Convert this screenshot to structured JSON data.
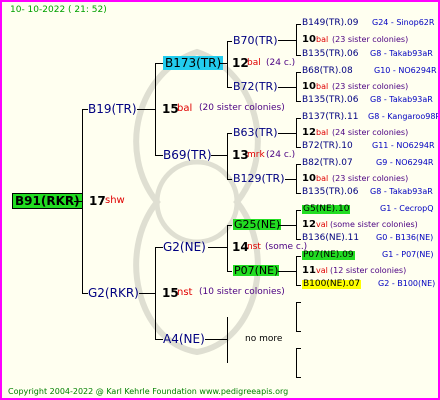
{
  "date": "10- 10-2022 ( 21: 52)",
  "footer": "Copyright 2004-2022 @ Karl Kehrle Foundation    www.pedigreeapis.org",
  "colors": {
    "frame": "#ff00ff",
    "highlight_green": "#22dd22",
    "highlight_cyan": "#22ccee",
    "highlight_yellow": "#ffff00",
    "red": "#e00000",
    "blue": "#0000c0"
  },
  "root": {
    "label": "B91(RKR)",
    "num": "17",
    "tag": "shw"
  },
  "gen1": [
    {
      "label": "B19(TR)",
      "num": "15",
      "tag": "bal",
      "note": "(20 sister colonies)"
    },
    {
      "label": "G2(RKR)",
      "num": "15",
      "tag": "nst",
      "note": "(10 sister colonies)"
    }
  ],
  "gen2": [
    {
      "label": "B173(TR)",
      "num": "12",
      "tag": "bal",
      "note": "(24 c.)"
    },
    {
      "label": "B69(TR)",
      "num": "13",
      "tag": "mrk",
      "note": "(24 c.)"
    },
    {
      "label": "G2(NE)",
      "num": "14",
      "tag": "nst",
      "note": "(some c.)"
    },
    {
      "label": "A4(NE)",
      "more": "no more"
    }
  ],
  "gen3": [
    {
      "label": "B70(TR)"
    },
    {
      "label": "B72(TR)"
    },
    {
      "label": "B63(TR)"
    },
    {
      "label": "B129(TR)"
    },
    {
      "label": "G25(NE)"
    },
    {
      "label": "P07(NE)"
    }
  ],
  "gen4": [
    {
      "label": "B149(TR).09",
      "code": "G24 - Sinop62R"
    },
    {
      "label": "10",
      "tag": "bal",
      "note": "(23 sister colonies)"
    },
    {
      "label": "B135(TR).06",
      "code": "G8 - Takab93aR"
    },
    {
      "label": "B68(TR).08",
      "code": "G10 - NO6294R"
    },
    {
      "label": "10",
      "tag": "bal",
      "note": "(23 sister colonies)"
    },
    {
      "label": "B135(TR).06",
      "code": "G8 - Takab93aR"
    },
    {
      "label": "B137(TR).11",
      "code": "G8 - Kangaroo98R"
    },
    {
      "label": "12",
      "tag": "bal",
      "note": "(24 sister colonies)"
    },
    {
      "label": "B72(TR).10",
      "code": "G11 - NO6294R"
    },
    {
      "label": "B82(TR).07",
      "code": "G9 - NO6294R"
    },
    {
      "label": "10",
      "tag": "bal",
      "note": "(23 sister colonies)"
    },
    {
      "label": "B135(TR).06",
      "code": "G8 - Takab93aR"
    },
    {
      "label": "G5(NE).10",
      "code": "G1 - CecropQ"
    },
    {
      "label": "12",
      "tag": "val",
      "note": "(some sister colonies)"
    },
    {
      "label": "B136(NE).11",
      "code": "G0 - B136(NE)"
    },
    {
      "label": "P07(NE).09",
      "code": "G1 - P07(NE)"
    },
    {
      "label": "11",
      "tag": "val",
      "note": "(12 sister colonies)"
    },
    {
      "label": "B100(NE).07",
      "code": "G2 - B100(NE)"
    }
  ]
}
